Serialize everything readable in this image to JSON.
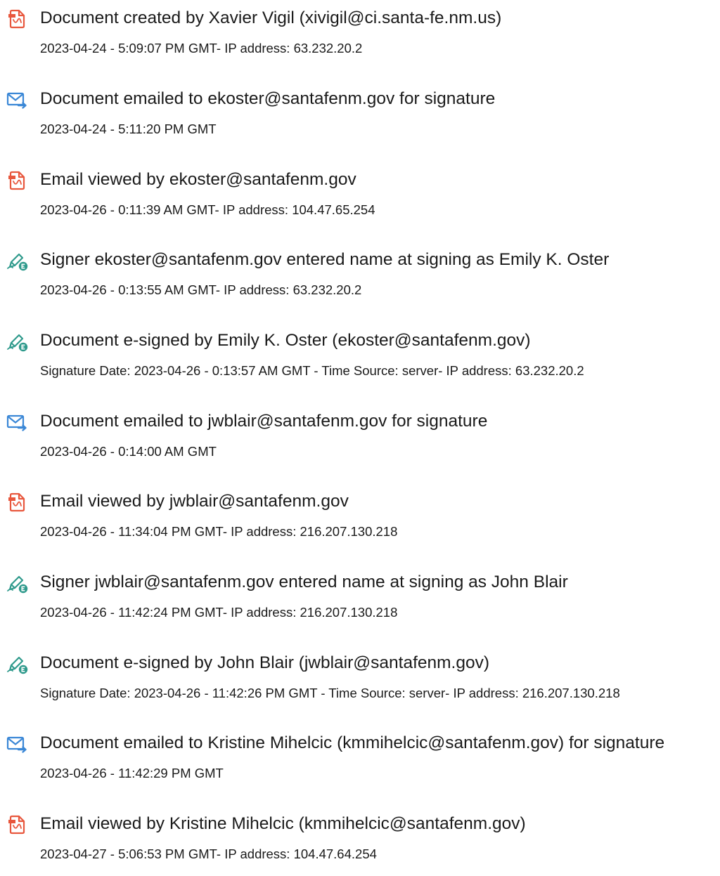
{
  "colors": {
    "document_icon": "#e8573d",
    "email_icon": "#3a87d6",
    "sign_icon": "#2f9a8c",
    "text": "#1a1a1a"
  },
  "events": [
    {
      "icon": "document-icon",
      "title": "Document created by Xavier Vigil (xivigil@ci.santa-fe.nm.us)",
      "detail": "2023-04-24 - 5:09:07 PM GMT- IP address: 63.232.20.2"
    },
    {
      "icon": "email-sent-icon",
      "title": "Document emailed to ekoster@santafenm.gov for signature",
      "detail": "2023-04-24 - 5:11:20 PM GMT"
    },
    {
      "icon": "document-icon",
      "title": "Email viewed by ekoster@santafenm.gov",
      "detail": "2023-04-26 - 0:11:39 AM GMT- IP address: 104.47.65.254"
    },
    {
      "icon": "e-sign-pen-icon",
      "title": "Signer ekoster@santafenm.gov entered name at signing as Emily K. Oster",
      "detail": "2023-04-26 - 0:13:55 AM GMT- IP address: 63.232.20.2"
    },
    {
      "icon": "e-sign-pen-icon",
      "title": "Document e-signed by Emily K. Oster (ekoster@santafenm.gov)",
      "detail": "Signature Date: 2023-04-26 - 0:13:57 AM GMT - Time Source: server- IP address: 63.232.20.2"
    },
    {
      "icon": "email-sent-icon",
      "title": "Document emailed to jwblair@santafenm.gov for signature",
      "detail": "2023-04-26 - 0:14:00 AM GMT"
    },
    {
      "icon": "document-icon",
      "title": "Email viewed by jwblair@santafenm.gov",
      "detail": "2023-04-26 - 11:34:04 PM GMT- IP address: 216.207.130.218"
    },
    {
      "icon": "e-sign-pen-icon",
      "title": "Signer jwblair@santafenm.gov entered name at signing as John Blair",
      "detail": "2023-04-26 - 11:42:24 PM GMT- IP address: 216.207.130.218"
    },
    {
      "icon": "e-sign-pen-icon",
      "title": "Document e-signed by John Blair (jwblair@santafenm.gov)",
      "detail": "Signature Date: 2023-04-26 - 11:42:26 PM GMT - Time Source: server- IP address: 216.207.130.218"
    },
    {
      "icon": "email-sent-icon",
      "title": "Document emailed to Kristine Mihelcic (kmmihelcic@santafenm.gov) for signature",
      "detail": "2023-04-26 - 11:42:29 PM GMT"
    },
    {
      "icon": "document-icon",
      "title": "Email viewed by Kristine Mihelcic (kmmihelcic@santafenm.gov)",
      "detail": "2023-04-27 - 5:06:53 PM GMT- IP address: 104.47.64.254"
    }
  ]
}
